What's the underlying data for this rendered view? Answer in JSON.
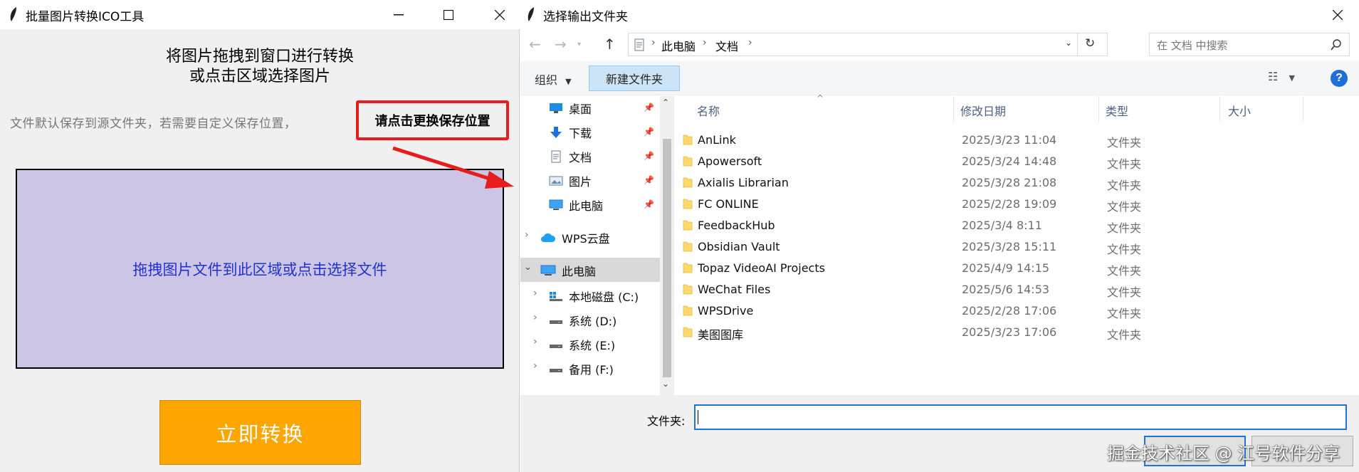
{
  "left_window": {
    "title": "批量图片转换ICO工具",
    "heading_line1": "将图片拖拽到窗口进行转换",
    "heading_line2": "或点击区域选择图片",
    "hint": "文件默认保存到源文件夹，若需要自定义保存位置，",
    "save_location_button": "请点击更换保存位置",
    "drop_zone_text": "拖拽图片文件到此区域或点击选择文件",
    "convert_button": "立即转换",
    "colors": {
      "drop_zone_bg": "#cdc5e6",
      "drop_zone_text": "#1f33c9",
      "convert_bg": "#ffa500",
      "highlight_border": "#e81c1c"
    }
  },
  "dialog": {
    "title": "选择输出文件夹",
    "breadcrumb": [
      "此电脑",
      "文档"
    ],
    "search_placeholder": "在 文档 中搜索",
    "organize_button": "组织",
    "new_folder_button": "新建文件夹",
    "nav": {
      "quick_access": [
        {
          "label": "桌面",
          "icon": "desktop-icon"
        },
        {
          "label": "下载",
          "icon": "download-icon"
        },
        {
          "label": "文档",
          "icon": "documents-icon"
        },
        {
          "label": "图片",
          "icon": "pictures-icon"
        },
        {
          "label": "此电脑",
          "icon": "computer-icon"
        }
      ],
      "wps_cloud": "WPS云盘",
      "this_pc": "此电脑",
      "drives": [
        {
          "label": "本地磁盘 (C:)"
        },
        {
          "label": "系统 (D:)"
        },
        {
          "label": "系统 (E:)"
        },
        {
          "label": "备用 (F:)"
        }
      ]
    },
    "columns": [
      "名称",
      "修改日期",
      "类型",
      "大小"
    ],
    "files": [
      {
        "name": "AnLink",
        "date": "2025/3/23 11:04",
        "type": "文件夹"
      },
      {
        "name": "Apowersoft",
        "date": "2025/3/24 14:48",
        "type": "文件夹"
      },
      {
        "name": "Axialis Librarian",
        "date": "2025/3/28 21:08",
        "type": "文件夹"
      },
      {
        "name": "FC ONLINE",
        "date": "2025/2/28 19:09",
        "type": "文件夹"
      },
      {
        "name": "FeedbackHub",
        "date": "2025/3/4 8:11",
        "type": "文件夹"
      },
      {
        "name": "Obsidian Vault",
        "date": "2025/3/28 15:11",
        "type": "文件夹"
      },
      {
        "name": "Topaz VideoAI Projects",
        "date": "2025/4/9 14:15",
        "type": "文件夹"
      },
      {
        "name": "WeChat Files",
        "date": "2025/5/6 14:53",
        "type": "文件夹"
      },
      {
        "name": "WPSDrive",
        "date": "2025/2/28 17:06",
        "type": "文件夹"
      },
      {
        "name": "美图图库",
        "date": "2025/3/23 17:06",
        "type": "文件夹"
      }
    ],
    "folder_label": "文件夹:",
    "folder_value": ""
  },
  "watermark": "掘金技术社区 @ 江号软件分享"
}
